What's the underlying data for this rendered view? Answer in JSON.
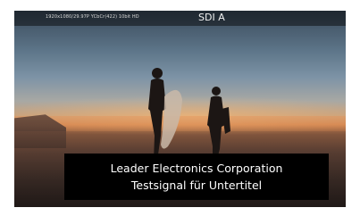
{
  "status_bar": {
    "format": "1920x1080/29.97P YCbCr(422) 10bit HD",
    "source": "SDI A"
  },
  "subtitle": {
    "line1": "Leader Electronics Corporation",
    "line2": "Testsignal für Untertitel"
  }
}
